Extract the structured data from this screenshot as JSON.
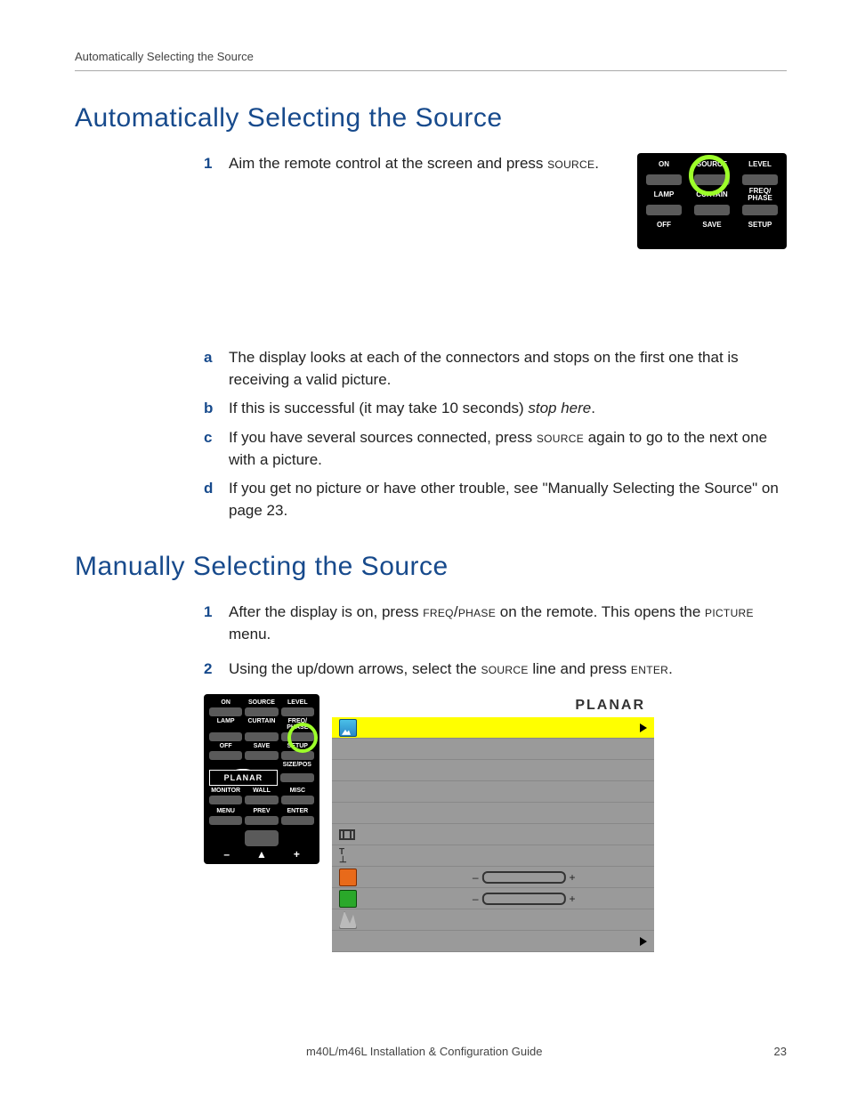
{
  "running_head": "Automatically Selecting the Source",
  "sections": {
    "auto": {
      "title": "Automatically Selecting the Source",
      "step1_pre": "Aim the remote control at the screen and press ",
      "step1_key": "source",
      "step1_post": ".",
      "a": "The display looks at each of the connectors and stops on the first one that is receiving a valid picture.",
      "b_pre": "If this is successful (it may take 10 seconds) ",
      "b_ital": "stop here",
      "b_post": ".",
      "c_pre": "If you have several sources connected, press ",
      "c_key": "source",
      "c_post": " again to go to the next one with a picture.",
      "d": "If you get no picture or have other trouble, see \"Manually Selecting the Source\" on page 23."
    },
    "manual": {
      "title": "Manually Selecting the Source",
      "s1_a": "After the display is on, press ",
      "s1_key1": "freq/phase",
      "s1_b": " on the remote. This opens the ",
      "s1_key2": "picture",
      "s1_c": " menu.",
      "s2_a": "Using the up/down arrows, select the ",
      "s2_key1": "source",
      "s2_b": " line and press ",
      "s2_key2": "enter",
      "s2_c": "."
    }
  },
  "remote_labels": {
    "on": "ON",
    "source": "SOURCE",
    "level": "LEVEL",
    "lamp": "LAMP",
    "curtain": "CURTAIN",
    "freqphase": "FREQ/\nPHASE",
    "off": "OFF",
    "save": "SAVE",
    "setup": "SETUP",
    "sizepos": "SIZE/POS",
    "planar": "PLANAR",
    "misc": "MISC",
    "monitor": "MONITOR",
    "wall": "WALL",
    "menu": "MENU",
    "prev": "PREV",
    "enter": "ENTER",
    "minus": "–",
    "plus": "+",
    "up": "▲"
  },
  "osd": {
    "brand": "PLANAR"
  },
  "footer": {
    "title": "m40L/m46L Installation & Configuration Guide",
    "page": "23"
  },
  "markers": {
    "n1": "1",
    "n2": "2",
    "a": "a",
    "b": "b",
    "c": "c",
    "d": "d"
  }
}
